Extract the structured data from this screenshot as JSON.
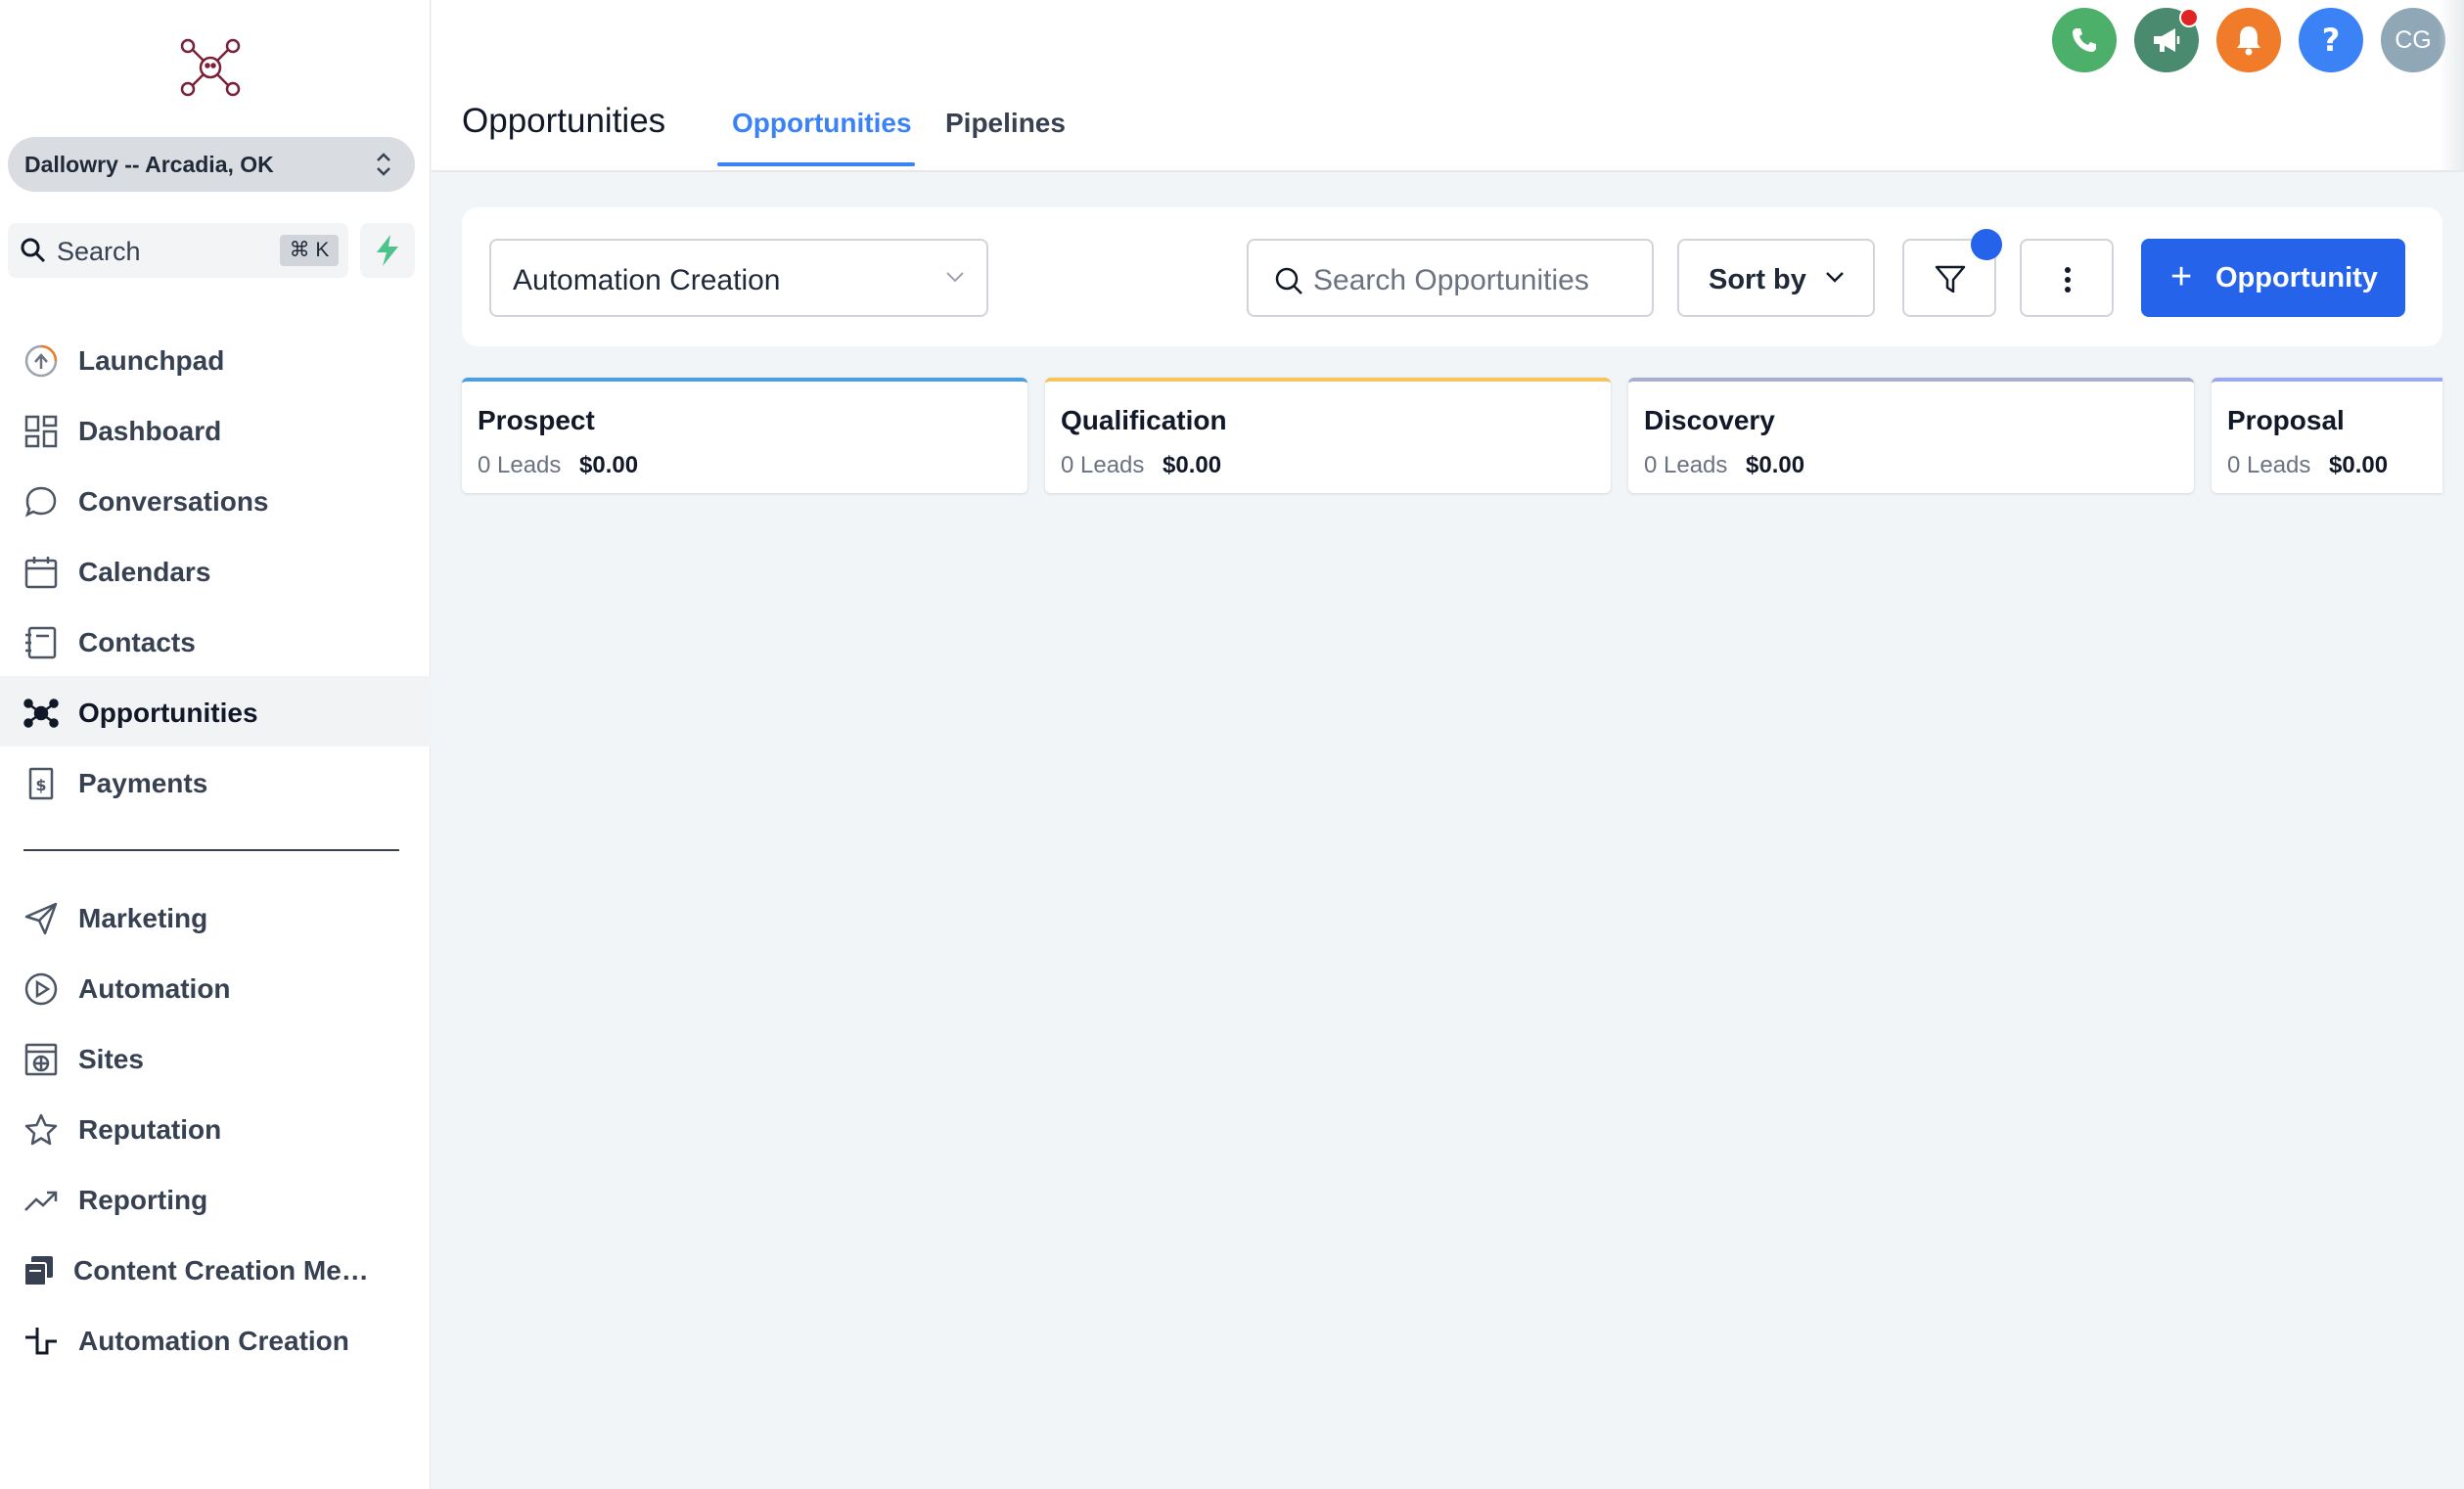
{
  "sidebar": {
    "location": "Dallowry -- Arcadia, OK",
    "search_label": "Search",
    "search_shortcut": "⌘ K",
    "items": [
      {
        "label": "Launchpad",
        "icon": "launchpad-icon"
      },
      {
        "label": "Dashboard",
        "icon": "dashboard-icon"
      },
      {
        "label": "Conversations",
        "icon": "chat-bubble-icon"
      },
      {
        "label": "Calendars",
        "icon": "calendar-icon"
      },
      {
        "label": "Contacts",
        "icon": "contacts-book-icon"
      },
      {
        "label": "Opportunities",
        "icon": "network-icon",
        "active": true
      },
      {
        "label": "Payments",
        "icon": "payments-icon"
      }
    ],
    "items2": [
      {
        "label": "Marketing",
        "icon": "paper-plane-icon"
      },
      {
        "label": "Automation",
        "icon": "automation-icon"
      },
      {
        "label": "Sites",
        "icon": "globe-window-icon"
      },
      {
        "label": "Reputation",
        "icon": "star-icon"
      },
      {
        "label": "Reporting",
        "icon": "trend-up-icon"
      },
      {
        "label": "Content Creation Memb...",
        "icon": "stacked-pages-icon"
      },
      {
        "label": "Automation Creation",
        "icon": "step-line-icon"
      }
    ]
  },
  "header": {
    "title": "Opportunities",
    "tabs": [
      {
        "label": "Opportunities",
        "active": true
      },
      {
        "label": "Pipelines",
        "active": false
      }
    ],
    "avatar_initials": "CG",
    "colors": {
      "phone": "#4caf6a",
      "announce": "#4a8a6e",
      "bell": "#f07c2a",
      "help": "#3b82f6",
      "avatar": "#8fa7b6"
    }
  },
  "toolbar": {
    "pipeline_selected": "Automation Creation",
    "search_placeholder": "Search Opportunities",
    "sort_label": "Sort by",
    "add_label": "Opportunity"
  },
  "stages": [
    {
      "name": "Prospect",
      "leads": "0 Leads",
      "amount": "$0.00",
      "color": "#4a9fe0"
    },
    {
      "name": "Qualification",
      "leads": "0 Leads",
      "amount": "$0.00",
      "color": "#f5c45a"
    },
    {
      "name": "Discovery",
      "leads": "0 Leads",
      "amount": "$0.00",
      "color": "#a9aed0"
    },
    {
      "name": "Proposal",
      "leads": "0 Leads",
      "amount": "$0.00",
      "color": "#9aa8f0"
    }
  ]
}
